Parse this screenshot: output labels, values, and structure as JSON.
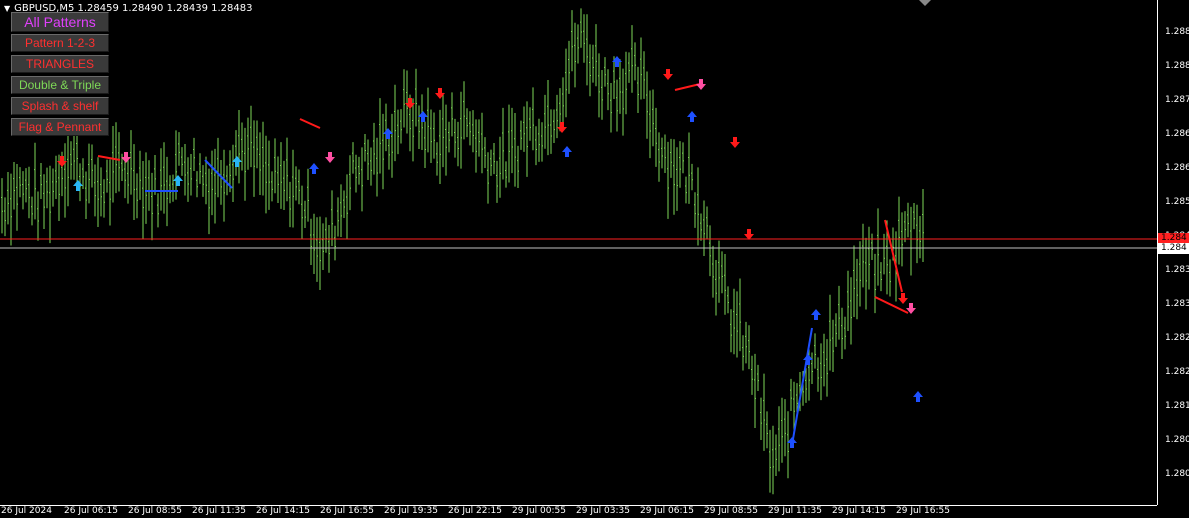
{
  "header": {
    "symbol_line": "GBPUSD,M5  1.28459 1.28490 1.28439 1.28483"
  },
  "panel": {
    "buttons": [
      {
        "label": "All Patterns",
        "color": "#e040fb"
      },
      {
        "label": "Pattern 1-2-3",
        "color": "#ff3030"
      },
      {
        "label": "TRIANGLES",
        "color": "#ff3030"
      },
      {
        "label": "Double & Triple",
        "color": "#7ed957"
      },
      {
        "label": "Splash & shelf",
        "color": "#ff3030"
      },
      {
        "label": "Flag & Pennant",
        "color": "#ff3030"
      }
    ]
  },
  "price_axis": {
    "labels": [
      "1.288",
      "1.288",
      "1.287",
      "1.286",
      "1.286",
      "1.285",
      "1.284",
      "1.283",
      "1.283",
      "1.282",
      "1.282",
      "1.281",
      "1.280",
      "1.280"
    ],
    "bid_tag": "1.284",
    "ask_tag": "1.284"
  },
  "time_axis": {
    "labels": [
      "26 Jul 2024",
      "26 Jul 06:15",
      "26 Jul 08:55",
      "26 Jul 11:35",
      "26 Jul 14:15",
      "26 Jul 16:55",
      "26 Jul 19:35",
      "26 Jul 22:15",
      "29 Jul 00:55",
      "29 Jul 03:35",
      "29 Jul 06:15",
      "29 Jul 08:55",
      "29 Jul 11:35",
      "29 Jul 14:15",
      "29 Jul 16:55"
    ]
  },
  "colors": {
    "candles": "#7ed957",
    "bid_line": "#c0c0c0",
    "ask_line": "#ff2020",
    "arrow_up": "#1e50ff",
    "arrow_up_light": "#29b6f6",
    "arrow_down": "#ff1a1a",
    "arrow_down_pink": "#ff4fa3"
  },
  "chart_data": {
    "type": "line",
    "title": "GBPUSD,M5",
    "xlabel": "",
    "ylabel": "",
    "x": [
      "26 Jul 2024",
      "26 Jul 06:15",
      "26 Jul 08:55",
      "26 Jul 11:35",
      "26 Jul 14:15",
      "26 Jul 16:55",
      "26 Jul 19:35",
      "26 Jul 22:15",
      "29 Jul 00:55",
      "29 Jul 03:35",
      "29 Jul 06:15",
      "29 Jul 08:55",
      "29 Jul 11:35",
      "29 Jul 14:15",
      "29 Jul 16:55"
    ],
    "series": [
      {
        "values": [
          1.2853,
          1.286,
          1.2858,
          1.286,
          1.2863,
          1.2847,
          1.2869,
          1.2868,
          1.2862,
          1.2883,
          1.2874,
          1.2849,
          1.2806,
          1.2831,
          1.2848
        ]
      }
    ],
    "ylim": [
      1.2797,
      1.2892
    ],
    "grid": false,
    "last_close": 1.28483
  }
}
